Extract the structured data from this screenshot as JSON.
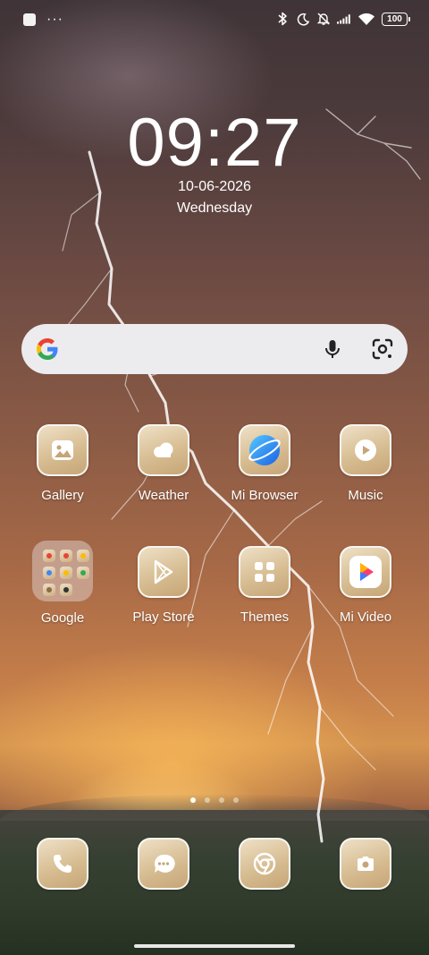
{
  "status_bar": {
    "left_icons": [
      "notification-square-icon",
      "more-dots-icon"
    ],
    "more_dots": "···",
    "right_icons": [
      "bluetooth-icon",
      "do-not-disturb-moon-icon",
      "muted-bell-icon",
      "cellular-signal-icon",
      "wifi-icon"
    ],
    "battery": "100"
  },
  "clock": {
    "time": "09:27",
    "date": "10-06-2026",
    "day": "Wednesday"
  },
  "search_bar": {
    "icons": [
      "google-g-icon",
      "microphone-icon",
      "google-lens-icon"
    ]
  },
  "apps": [
    {
      "label": "Gallery",
      "icon": "gallery-icon"
    },
    {
      "label": "Weather",
      "icon": "weather-cloud-icon"
    },
    {
      "label": "Mi Browser",
      "icon": "mi-browser-icon"
    },
    {
      "label": "Music",
      "icon": "music-play-icon"
    },
    {
      "label": "Google",
      "icon": "google-folder-icon"
    },
    {
      "label": "Play Store",
      "icon": "play-store-icon"
    },
    {
      "label": "Themes",
      "icon": "themes-grid-icon"
    },
    {
      "label": "Mi Video",
      "icon": "mi-video-icon"
    }
  ],
  "page_indicator": {
    "pages": 4,
    "active_page": 1
  },
  "dock": [
    {
      "name": "phone",
      "icon": "phone-icon"
    },
    {
      "name": "messages",
      "icon": "messages-icon"
    },
    {
      "name": "chrome",
      "icon": "chrome-icon"
    },
    {
      "name": "camera",
      "icon": "camera-icon"
    }
  ],
  "colors": {
    "icon_gold_light": "#eee0c6",
    "icon_gold_dark": "#c6a577",
    "search_bg": "#ececef"
  }
}
